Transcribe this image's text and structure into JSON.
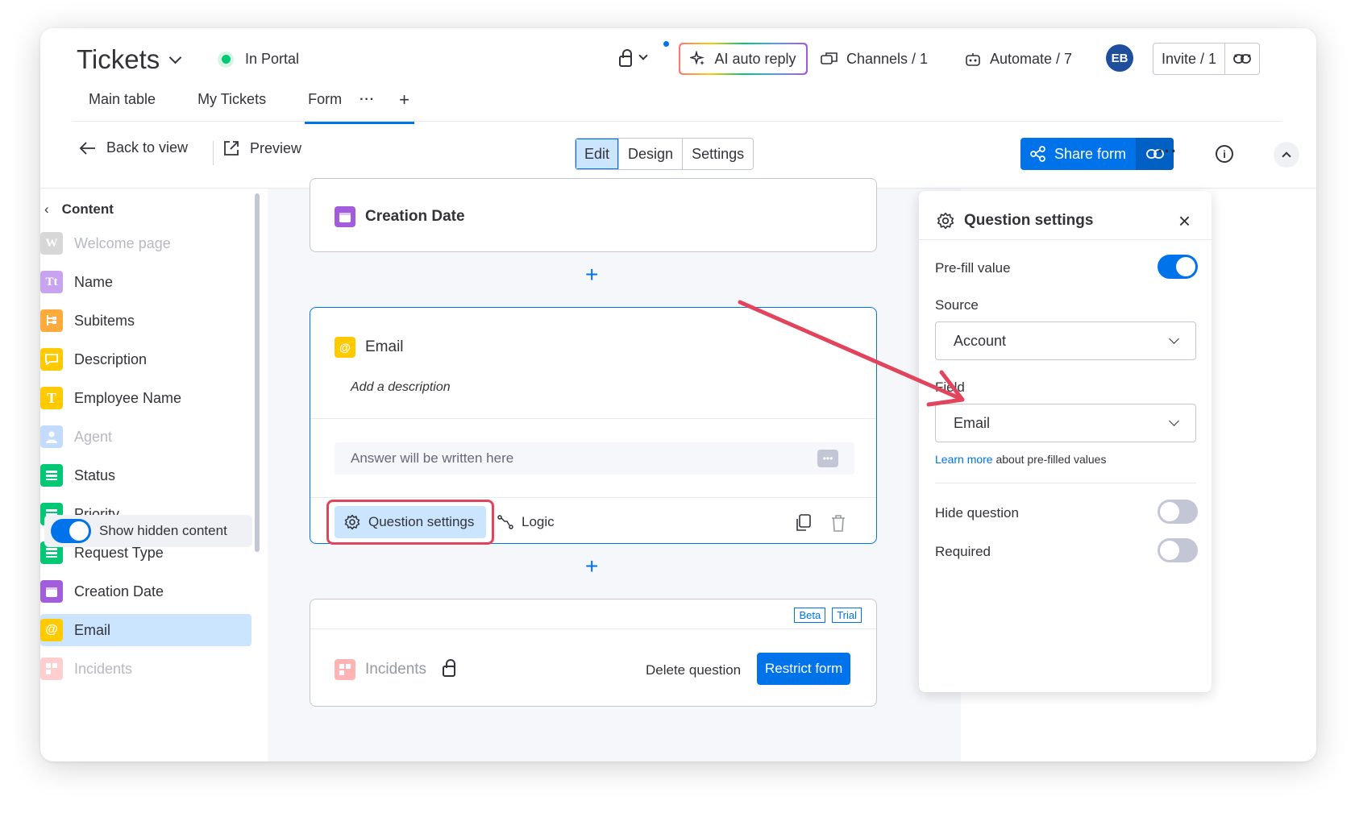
{
  "header": {
    "title": "Tickets",
    "status_label": "In Portal",
    "ai_button": "AI auto reply",
    "channels": "Channels / 1",
    "automate": "Automate / 7",
    "avatar_initials": "EB",
    "invite": "Invite / 1"
  },
  "tabs": [
    "Main table",
    "My Tickets",
    "Form"
  ],
  "toolbar": {
    "back": "Back to view",
    "preview": "Preview",
    "modes": [
      "Edit",
      "Design",
      "Settings"
    ],
    "share": "Share form"
  },
  "sidebar": {
    "heading": "Content",
    "items": [
      {
        "label": "Welcome page",
        "icon": "W",
        "color": "#8f8f8f"
      },
      {
        "label": "Name",
        "icon": "Tt",
        "color": "#a25ddc"
      },
      {
        "label": "Subitems",
        "icon": "subitems-icon",
        "color": "#fdab3d"
      },
      {
        "label": "Description",
        "icon": "comment-icon",
        "color": "#ffcb00"
      },
      {
        "label": "Employee Name",
        "icon": "T",
        "color": "#ffcb00"
      },
      {
        "label": "Agent",
        "icon": "person-icon",
        "color": "#579bfc"
      },
      {
        "label": "Status",
        "icon": "status-icon",
        "color": "#00c875"
      },
      {
        "label": "Priority",
        "icon": "status-icon",
        "color": "#00c875"
      },
      {
        "label": "Request Type",
        "icon": "status-icon",
        "color": "#00c875"
      },
      {
        "label": "Creation Date",
        "icon": "calendar-icon",
        "color": "#a25ddc"
      },
      {
        "label": "Email",
        "icon": "@",
        "color": "#ffcb00"
      },
      {
        "label": "Incidents",
        "icon": "board-icon",
        "color": "#ff7575"
      }
    ],
    "toggle_label": "Show hidden content"
  },
  "canvas": {
    "creation_date": "Creation Date",
    "email_title": "Email",
    "email_desc": "Add a description",
    "email_placeholder": "Answer will be written here",
    "question_settings": "Question settings",
    "logic": "Logic",
    "badge_beta": "Beta",
    "badge_trial": "Trial",
    "incidents": "Incidents",
    "delete_question": "Delete question",
    "restrict_form": "Restrict form"
  },
  "panel": {
    "title": "Question settings",
    "prefill_label": "Pre-fill value",
    "prefill_on": true,
    "source_label": "Source",
    "source_value": "Account",
    "field_label": "Field",
    "field_value": "Email",
    "learn_more": "Learn more",
    "learn_more_rest": "about pre-filled values",
    "hide_label": "Hide question",
    "required_label": "Required"
  },
  "colors": {
    "accent": "#0073ea",
    "annotation": "#e2445c"
  }
}
